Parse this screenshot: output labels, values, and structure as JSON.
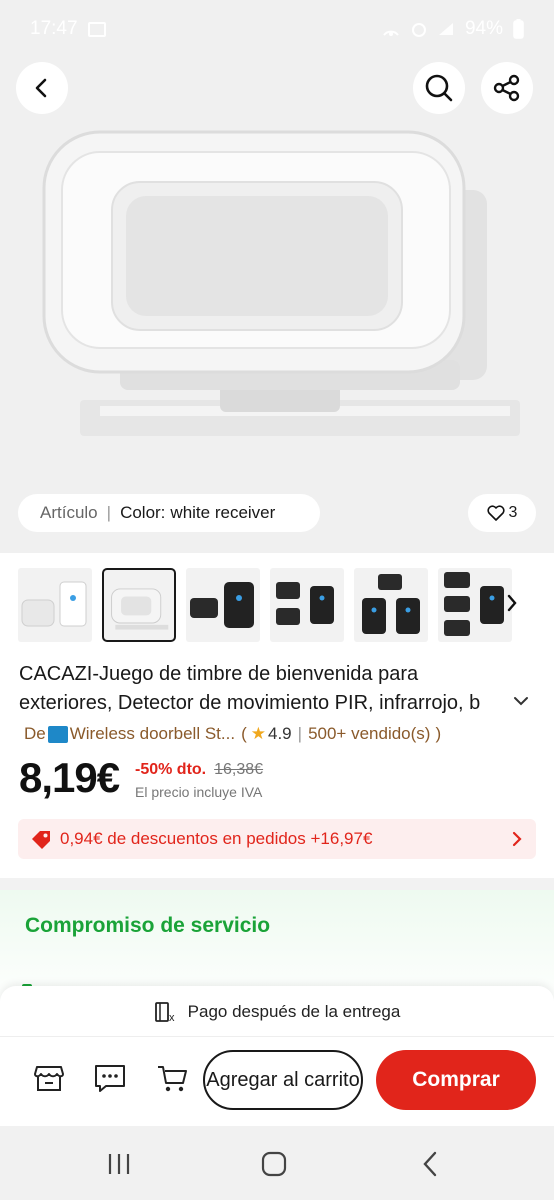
{
  "status_bar": {
    "time": "17:47",
    "battery": "94%"
  },
  "hero": {
    "article_label": "Artículo",
    "separator": "|",
    "color_label": "Color:",
    "color_value": "white receiver",
    "favorites_count": "3"
  },
  "thumbnails": {
    "count": 7,
    "selected_index": 1
  },
  "product": {
    "title": "CACAZI-Juego de timbre de bienvenida para exteriores, Detector de movimiento PIR, infrarrojo, b",
    "store_prefix": "De",
    "store_name": "Wireless doorbell St...",
    "rating": "4.9",
    "sold": "500+ vendido(s)",
    "price": "8,19€",
    "discount_pct": "-50% dto.",
    "original_price": "16,38€",
    "vat_note": "El precio incluye IVA"
  },
  "promo": {
    "text": "0,94€ de descuentos en pedidos +16,97€"
  },
  "service": {
    "title": "Compromiso de servicio"
  },
  "bottom_bar": {
    "pay_note": "Pago después de la entrega",
    "add_to_cart": "Agregar al carrito",
    "buy": "Comprar"
  },
  "colors": {
    "accent_red": "#e1251b",
    "service_green": "#1aa338",
    "store_brown": "#8a5a2b"
  }
}
